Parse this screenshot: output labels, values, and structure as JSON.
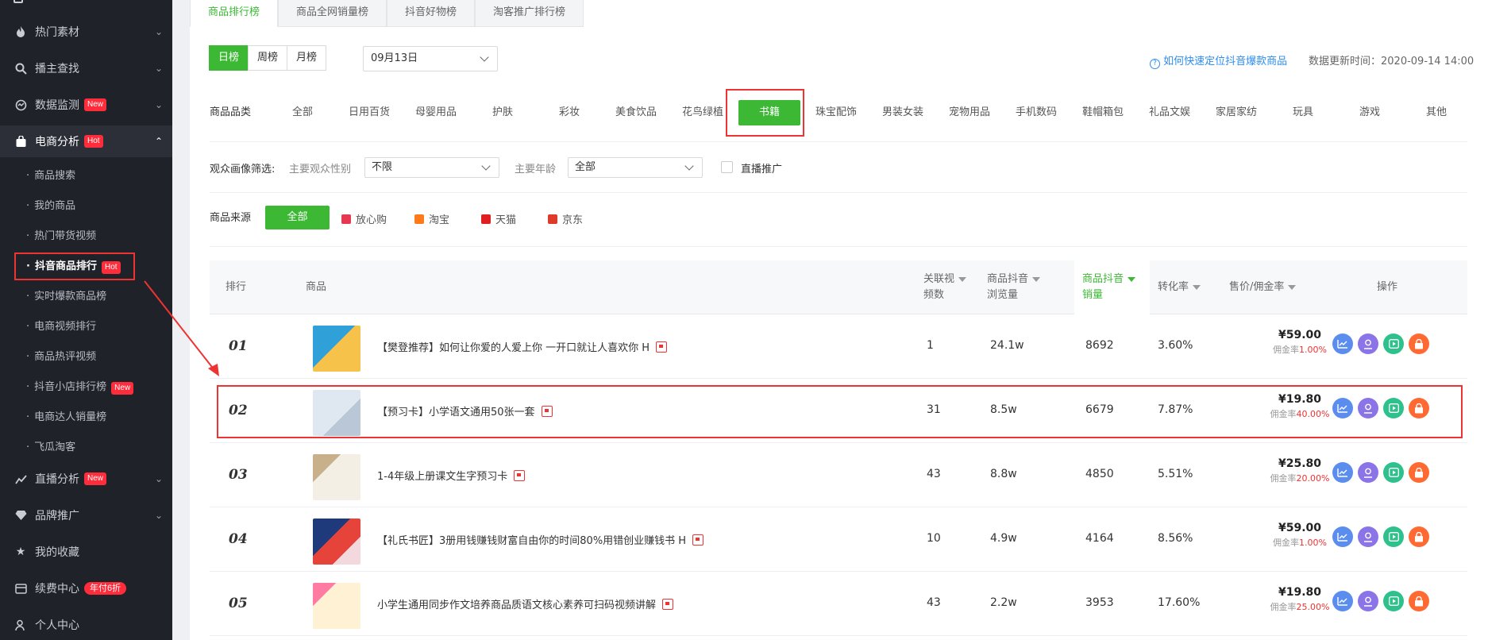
{
  "sidebar": {
    "items": [
      {
        "label": "热门素材",
        "icon": "flame-icon"
      },
      {
        "label": "播主查找",
        "icon": "search-icon"
      },
      {
        "label": "数据监测",
        "icon": "monitor-icon",
        "badge": "New"
      },
      {
        "label": "电商分析",
        "icon": "bag-icon",
        "badge": "Hot"
      },
      {
        "label": "直播分析",
        "icon": "chart-line-icon",
        "badge": "New"
      },
      {
        "label": "品牌推广",
        "icon": "diamond-icon"
      },
      {
        "label": "我的收藏",
        "icon": "star-icon"
      },
      {
        "label": "续费中心",
        "icon": "card-icon",
        "badge": "年付6折"
      },
      {
        "label": "个人中心",
        "icon": "user-icon"
      }
    ],
    "sub_items": [
      {
        "label": "商品搜索"
      },
      {
        "label": "我的商品"
      },
      {
        "label": "热门带货视频"
      },
      {
        "label": "抖音商品排行",
        "badge": "Hot"
      },
      {
        "label": "实时爆款商品榜"
      },
      {
        "label": "电商视频排行"
      },
      {
        "label": "商品热评视频"
      },
      {
        "label": "抖音小店排行榜",
        "badge": "New"
      },
      {
        "label": "电商达人销量榜"
      },
      {
        "label": "飞瓜淘客"
      }
    ]
  },
  "tabs": [
    "商品排行榜",
    "商品全网销量榜",
    "抖音好物榜",
    "淘客推广排行榜"
  ],
  "period": {
    "options": [
      "日榜",
      "周榜",
      "月榜"
    ],
    "date": "09月13日"
  },
  "help_link": "如何快速定位抖音爆款商品",
  "update_time": "数据更新时间：2020-09-14 14:00",
  "category": {
    "label": "商品品类",
    "items": [
      "全部",
      "日用百货",
      "母婴用品",
      "护肤",
      "彩妆",
      "美食饮品",
      "花鸟绿植",
      "书籍",
      "珠宝配饰",
      "男装女装",
      "宠物用品",
      "手机数码",
      "鞋帽箱包",
      "礼品文娱",
      "家居家纺",
      "玩具",
      "游戏",
      "其他"
    ],
    "selected": "书籍"
  },
  "audience": {
    "label": "观众画像筛选:",
    "gender_label": "主要观众性别",
    "gender_value": "不限",
    "age_label": "主要年龄",
    "age_value": "全部",
    "live_label": "直播推广"
  },
  "source": {
    "label": "商品来源",
    "all": "全部",
    "items": [
      "放心购",
      "淘宝",
      "天猫",
      "京东"
    ],
    "colors": [
      "#e8384f",
      "#ff7a1a",
      "#e02020",
      "#e03a2a"
    ]
  },
  "table": {
    "headers": {
      "rank": "排行",
      "product": "商品",
      "videos_l1": "关联视",
      "videos_l2": "频数",
      "views_l1": "商品抖音",
      "views_l2": "浏览量",
      "sales_l1": "商品抖音",
      "sales_l2": "销量",
      "conversion": "转化率",
      "price": "售价/佣金率",
      "actions": "操作"
    },
    "commission_label": "佣金率",
    "rows": [
      {
        "rank": "01",
        "name": "【樊登推荐】如何让你爱的人爱上你 一开口就让人喜欢你 H",
        "videos": "1",
        "views": "24.1w",
        "sales": "8692",
        "conversion": "3.60%",
        "price": "¥59.00",
        "commission": "1.00%"
      },
      {
        "rank": "02",
        "name": "【预习卡】小学语文通用50张一套",
        "videos": "31",
        "views": "8.5w",
        "sales": "6679",
        "conversion": "7.87%",
        "price": "¥19.80",
        "commission": "40.00%"
      },
      {
        "rank": "03",
        "name": "1-4年级上册课文生字预习卡",
        "videos": "43",
        "views": "8.8w",
        "sales": "4850",
        "conversion": "5.51%",
        "price": "¥25.80",
        "commission": "20.00%"
      },
      {
        "rank": "04",
        "name": "【礼氏书匠】3册用钱赚钱财富自由你的时间80%用错创业赚钱书 H",
        "videos": "10",
        "views": "4.9w",
        "sales": "4164",
        "conversion": "8.56%",
        "price": "¥59.00",
        "commission": "1.00%"
      },
      {
        "rank": "05",
        "name": "小学生通用同步作文培养商品质语文核心素养可扫码视频讲解",
        "videos": "43",
        "views": "2.2w",
        "sales": "3953",
        "conversion": "17.60%",
        "price": "¥19.80",
        "commission": "25.00%"
      }
    ]
  },
  "action_colors": [
    "#5b8def",
    "#8b73e8",
    "#2fc18c",
    "#ff6a33"
  ],
  "highlight_color": "#e33333",
  "accent_color": "#3cb835"
}
